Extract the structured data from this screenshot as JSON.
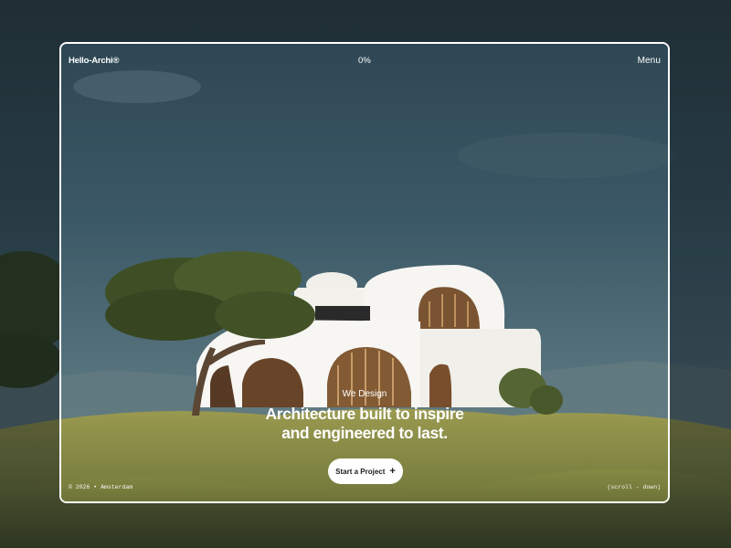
{
  "header": {
    "logo": "Hello-Archi®",
    "progress": "0%",
    "menu_label": "Menu"
  },
  "hero": {
    "eyebrow": "We Design",
    "headline_line1": "Architecture built to inspire",
    "headline_line2": "and engineered to last.",
    "cta_label": "Start a Project",
    "cta_icon": "plus-icon"
  },
  "footer": {
    "left": "© 2026 • Amsterdam",
    "right": "(scroll - down)"
  },
  "colors": {
    "frame_border": "#ffffff",
    "cta_bg": "#ffffff",
    "text": "#ffffff",
    "sky": "#2f4a55",
    "grass": "#7a7a3a"
  }
}
